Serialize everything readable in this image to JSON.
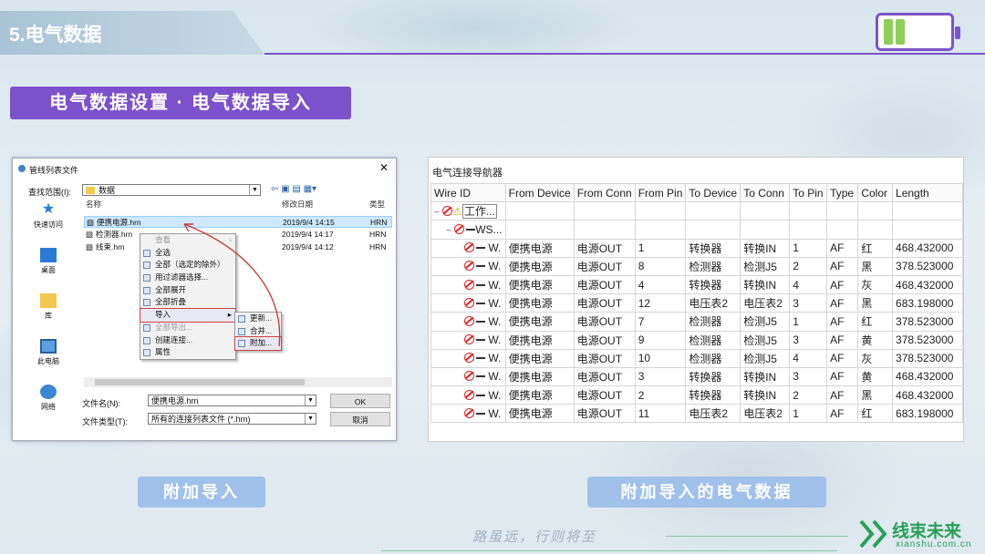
{
  "header": {
    "title": "5.电气数据",
    "banner": "电气数据设置 · 电气数据导入"
  },
  "dialog": {
    "title": "管线列表文件",
    "lookin_label": "查找范围(I):",
    "lookin_value": "数据",
    "places": [
      "快速访问",
      "桌面",
      "库",
      "此电脑",
      "网络"
    ],
    "columns": [
      "名称",
      "修改日期",
      "类型"
    ],
    "files": [
      {
        "name": "便携电源.hrn",
        "date": "2019/9/4 14:15",
        "type": "HRN"
      },
      {
        "name": "检测器.hrn",
        "date": "2019/9/4 14:17",
        "type": "HRN"
      },
      {
        "name": "线束.hrn",
        "date": "2019/9/4 14:12",
        "type": "HRN"
      }
    ],
    "filename_label": "文件名(N):",
    "filename_value": "便携电源.hrn",
    "filetype_label": "文件类型(T):",
    "filetype_value": "所有的连接列表文件 (*.hrn)",
    "ok": "OK",
    "cancel": "取消",
    "context_menu": [
      "查看",
      "全选",
      "全部（选定的除外）",
      "用过滤器选择...",
      "全部展开",
      "全部折叠",
      "导入",
      "全部导出...",
      "创建连接...",
      "属性"
    ],
    "submenu": [
      "更新...",
      "合并...",
      "附加..."
    ]
  },
  "navigator": {
    "title": "电气连接导航器",
    "columns": [
      "Wire ID",
      "From Device",
      "From Conn",
      "From Pin",
      "To Device",
      "To Conn",
      "To Pin",
      "Type",
      "Color",
      "Length"
    ],
    "root": "工作...",
    "group": "WS...",
    "wire_id": "W.",
    "rows": [
      [
        "便携电源",
        "电源OUT",
        "1",
        "转换器",
        "转换IN",
        "1",
        "AF",
        "红",
        "468.432000"
      ],
      [
        "便携电源",
        "电源OUT",
        "8",
        "检测器",
        "检测J5",
        "2",
        "AF",
        "黑",
        "378.523000"
      ],
      [
        "便携电源",
        "电源OUT",
        "4",
        "转换器",
        "转换IN",
        "4",
        "AF",
        "灰",
        "468.432000"
      ],
      [
        "便携电源",
        "电源OUT",
        "12",
        "电压表2",
        "电压表2",
        "3",
        "AF",
        "黑",
        "683.198000"
      ],
      [
        "便携电源",
        "电源OUT",
        "7",
        "检测器",
        "检测J5",
        "1",
        "AF",
        "红",
        "378.523000"
      ],
      [
        "便携电源",
        "电源OUT",
        "9",
        "检测器",
        "检测J5",
        "3",
        "AF",
        "黄",
        "378.523000"
      ],
      [
        "便携电源",
        "电源OUT",
        "10",
        "检测器",
        "检测J5",
        "4",
        "AF",
        "灰",
        "378.523000"
      ],
      [
        "便携电源",
        "电源OUT",
        "3",
        "转换器",
        "转换IN",
        "3",
        "AF",
        "黄",
        "468.432000"
      ],
      [
        "便携电源",
        "电源OUT",
        "2",
        "转换器",
        "转换IN",
        "2",
        "AF",
        "黑",
        "468.432000"
      ],
      [
        "便携电源",
        "电源OUT",
        "11",
        "电压表2",
        "电压表2",
        "1",
        "AF",
        "红",
        "683.198000"
      ]
    ]
  },
  "captions": {
    "left": "附加导入",
    "right": "附加导入的电气数据"
  },
  "footer": {
    "motto": "路虽远，行则将至",
    "brand": "线束未来",
    "domain": "xianshu.com.cn"
  },
  "colors": {
    "accent": "#7b52cb",
    "pill": "#9fc1ea",
    "brand": "#2aa05a"
  }
}
